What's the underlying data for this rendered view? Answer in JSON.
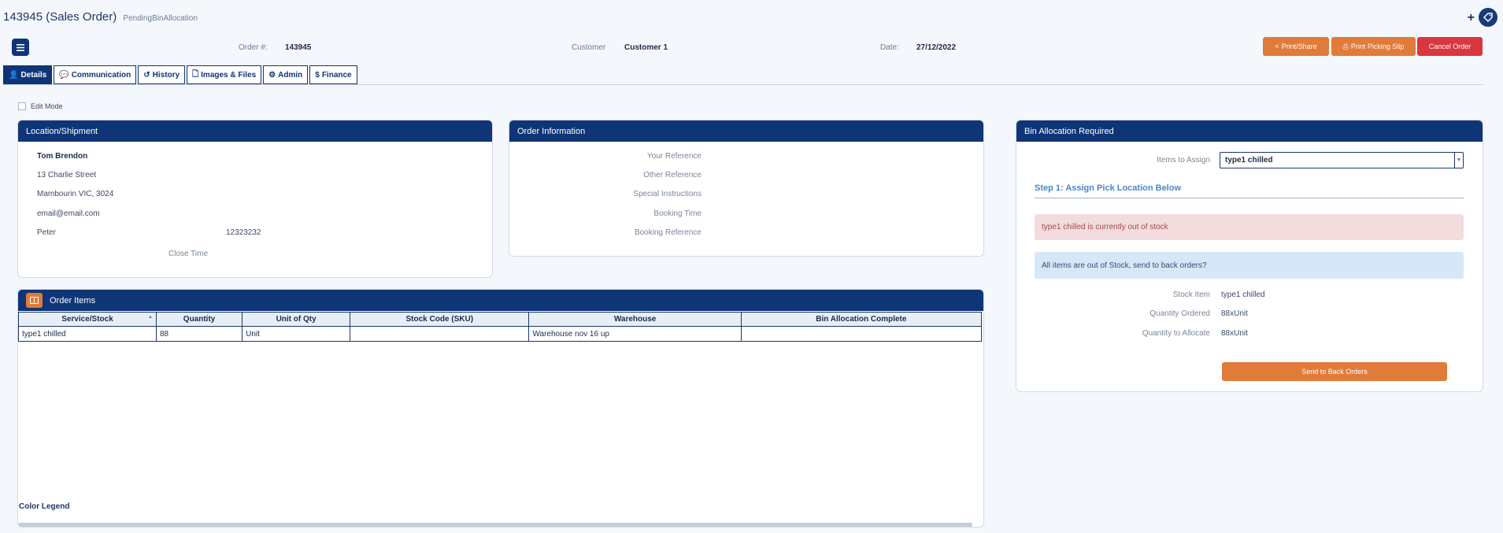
{
  "page": {
    "order_title": "143945 (Sales Order)",
    "status": "PendingBinAllocation",
    "plus_label": "+"
  },
  "header": {
    "order_label": "Order #:",
    "order_value": "143945",
    "customer_label": "Customer",
    "customer_value": "Customer 1",
    "date_label": "Date:",
    "date_value": "27/12/2022"
  },
  "actions": {
    "print_share": "Print/Share",
    "print_picking": "Print Picking Slip",
    "cancel": "Cancel Order"
  },
  "tabs": [
    {
      "label": "Details",
      "icon": "user-icon"
    },
    {
      "label": "Communication",
      "icon": "comment-icon"
    },
    {
      "label": "History",
      "icon": "history-icon"
    },
    {
      "label": "Images & Files",
      "icon": "file-icon"
    },
    {
      "label": "Admin",
      "icon": "gear-icon"
    },
    {
      "label": "Finance",
      "icon": "dollar-icon"
    }
  ],
  "tab_icons": {
    "user": "👤",
    "comment": "💬",
    "history": "↺",
    "file": "🗋",
    "gear": "⚙",
    "dollar": "$"
  },
  "edit_mode_label": "Edit Mode",
  "location": {
    "title": "Location/Shipment",
    "name": "Tom Brendon",
    "street": "13 Charlie Street",
    "suburb": "Mambourin VIC, 3024",
    "email": "email@email.com",
    "contact_name": "Peter",
    "contact_phone": "12323232",
    "close_time_label": "Close Time"
  },
  "order_info": {
    "title": "Order Information",
    "your_reference": "Your Reference",
    "other_reference": "Other Reference",
    "special_instructions": "Special Instructions",
    "booking_time": "Booking Time",
    "booking_reference": "Booking Reference"
  },
  "bin": {
    "title": "Bin Allocation Required",
    "items_label": "Items to Assign",
    "items_value": "type1 chilled",
    "step_title": "Step 1: Assign Pick Location Below",
    "out_of_stock_msg": "type1 chilled is currently out of stock",
    "back_order_msg": "All items are out of Stock, send to back orders?",
    "stock_item_label": "Stock Item",
    "stock_item_value": "type1 chilled",
    "qty_ordered_label": "Quantity Ordered",
    "qty_ordered_value": "88xUnit",
    "qty_allocate_label": "Quantity to Allocate",
    "qty_allocate_value": "88xUnit",
    "back_button": "Send to Back Orders"
  },
  "order_items": {
    "title": "Order Items",
    "columns": [
      "Service/Stock",
      "Quantity",
      "Unit of Qty",
      "Stock Code (SKU)",
      "Warehouse",
      "Bin Allocation Complete"
    ],
    "rows": [
      [
        "type1 chilled",
        "88",
        "Unit",
        "",
        "Warehouse nov 16 up",
        ""
      ]
    ],
    "legend": "Color Legend"
  },
  "colors": {
    "navy": "#0f3577",
    "orange": "#e07b3a",
    "red": "#d9363e"
  }
}
